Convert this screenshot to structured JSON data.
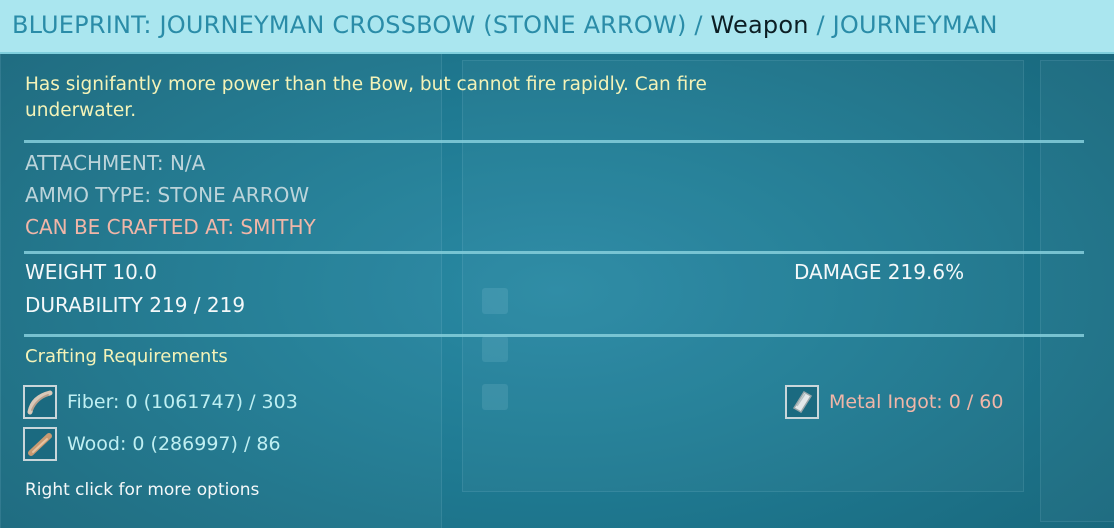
{
  "header": {
    "prefix": "BLUEPRINT: JOURNEYMAN CROSSBOW (STONE ARROW) /",
    "category": "Weapon",
    "suffix": "/ JOURNEYMAN"
  },
  "description": "Has signifantly more power than the Bow, but cannot fire rapidly.  Can fire underwater.",
  "info": {
    "attachment": "ATTACHMENT: N/A",
    "ammo_type": "AMMO TYPE: STONE ARROW",
    "crafted_at": "CAN BE CRAFTED AT: SMITHY"
  },
  "stats": {
    "weight": "WEIGHT 10.0",
    "durability": "DURABILITY 219 / 219",
    "damage": "DAMAGE 219.6%"
  },
  "crafting": {
    "title": "Crafting Requirements",
    "items": [
      {
        "label": "Fiber: 0 (1061747) / 303",
        "icon": "fiber-icon",
        "met": false
      },
      {
        "label": "Wood: 0 (286997) / 86",
        "icon": "wood-icon",
        "met": false
      },
      {
        "label": "Metal Ingot: 0 / 60",
        "icon": "metal-ingot-icon",
        "met": false
      }
    ]
  },
  "hint": "Right click for more options",
  "colors": {
    "header_bg": "#aae6ef",
    "panel_bg": "#1f7a92",
    "description": "#f4f3b8",
    "warning": "#f1b6a8"
  }
}
